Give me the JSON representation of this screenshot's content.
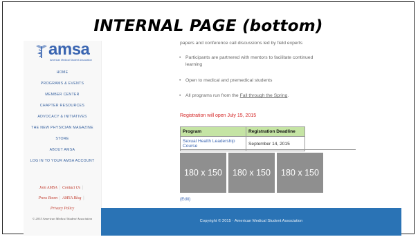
{
  "banner": "INTERNAL PAGE (bottom)",
  "logo": {
    "word": "amsa",
    "subtitle": "American Medical Student Association"
  },
  "sidebar": {
    "nav": [
      {
        "label": "HOME"
      },
      {
        "label": "PROGRAMS & EVENTS"
      },
      {
        "label": "MEMBER CENTER"
      },
      {
        "label": "CHAPTER RESOURCES"
      },
      {
        "label": "ADVOCACY & INITIATIVES"
      },
      {
        "label": "THE NEW PHYSICIAN MAGAZINE"
      },
      {
        "label": "STORE"
      },
      {
        "label": "ABOUT AMSA"
      },
      {
        "label": "LOG IN TO YOUR AMSA ACCOUNT"
      }
    ],
    "utility": {
      "join": "Join AMSA",
      "contact": "Contact Us",
      "press": "Press Room",
      "blog": "AMSA Blog",
      "privacy": "Privacy Policy",
      "separator": "|"
    },
    "copyright": "© 2015 American Medical Student Association"
  },
  "content": {
    "line1": "papers and conference call discussions led by field experts",
    "bullet1_a": "Participants are partnered with mentors to facilitate continued",
    "bullet1_b": "learning",
    "bullet2": "Open to medical and premedical students",
    "bullet3_pre": "All programs run from the ",
    "bullet3_link": "Fall through the Spring",
    "bullet3_post": ".",
    "registration_notice": "Registration will open July 15, 2015"
  },
  "table": {
    "headers": [
      "Program",
      "Registration Deadline"
    ],
    "rows": [
      [
        "Sexual Health Leadership Course",
        "September 14, 2015"
      ]
    ]
  },
  "placeholders": [
    "180 x 150",
    "180 x 150",
    "180 x 150"
  ],
  "edit_link": "(Edit)",
  "footer": {
    "copyright": "Copyright © 2015 · American Medical Student Association"
  },
  "colors": {
    "footer": "#2a73b5",
    "table_header": "#c5e4a4",
    "alert": "#d42424",
    "link": "#3a65b1"
  }
}
